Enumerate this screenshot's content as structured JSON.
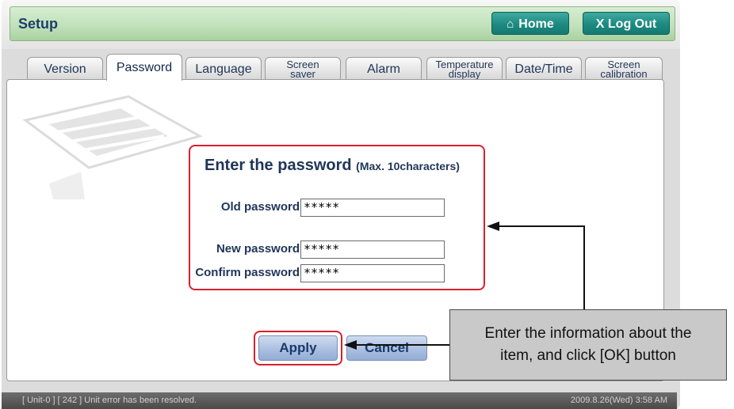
{
  "header": {
    "title": "Setup",
    "home_label": "Home",
    "logout_label": "X Log Out"
  },
  "tabs": [
    {
      "label": "Version",
      "line1": "",
      "line2": ""
    },
    {
      "label": "Password",
      "line1": "",
      "line2": ""
    },
    {
      "label": "Language",
      "line1": "",
      "line2": ""
    },
    {
      "label": "",
      "line1": "Screen",
      "line2": "saver"
    },
    {
      "label": "Alarm",
      "line1": "",
      "line2": ""
    },
    {
      "label": "",
      "line1": "Temperature",
      "line2": "display"
    },
    {
      "label": "Date/Time",
      "line1": "",
      "line2": ""
    },
    {
      "label": "",
      "line1": "Screen",
      "line2": "calibration"
    }
  ],
  "active_tab": "Password",
  "form": {
    "title": "Enter the password",
    "max_note": "(Max. 10characters)",
    "old_label": "Old password",
    "old_value": "*****",
    "new_label": "New password",
    "new_value": "*****",
    "confirm_label": "Confirm password",
    "confirm_value": "*****"
  },
  "buttons": {
    "apply": "Apply",
    "cancel": "Cancel"
  },
  "status": {
    "message": "[ Unit-0 ] [ 242 ] Unit error has been resolved.",
    "datetime": "2009.8.26(Wed)  3:58 AM"
  },
  "callout": {
    "line1": "Enter the information about the",
    "line2": "item, and click [OK] button"
  },
  "colors": {
    "header_green": "#bfe0b8",
    "button_teal": "#1d8a81",
    "highlight_red": "#d8202c",
    "text_navy": "#1f3558"
  }
}
